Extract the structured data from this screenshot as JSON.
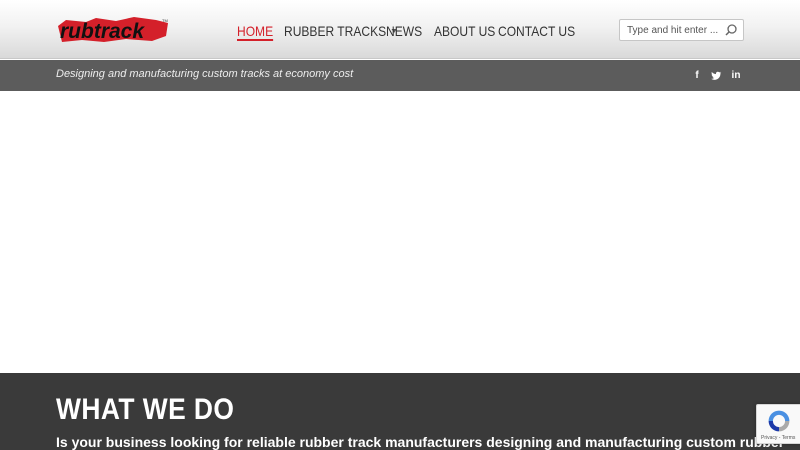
{
  "header": {
    "logo_text": "rubtrack",
    "nav": [
      {
        "label": "HOME",
        "active": true
      },
      {
        "label": "RUBBER TRACKS",
        "has_dropdown": true
      },
      {
        "label": "NEWS"
      },
      {
        "label": "ABOUT US"
      },
      {
        "label": "CONTACT US"
      }
    ],
    "search": {
      "placeholder": "Type and hit enter ..."
    }
  },
  "tagbar": {
    "tagline": "Designing and manufacturing custom tracks at economy cost",
    "social": [
      {
        "icon": "facebook-icon",
        "glyph": "f"
      },
      {
        "icon": "twitter-icon",
        "glyph": "t"
      },
      {
        "icon": "linkedin-icon",
        "glyph": "in"
      }
    ]
  },
  "section": {
    "title": "WHAT WE DO",
    "text": "Is your business looking for reliable rubber track manufacturers designing and manufacturing custom rubber"
  },
  "recaptcha": {
    "links": "Privacy - Terms"
  },
  "colors": {
    "accent": "#d4202a",
    "tagbar": "#5c5c5c",
    "section_bg": "#3a3a3a"
  }
}
